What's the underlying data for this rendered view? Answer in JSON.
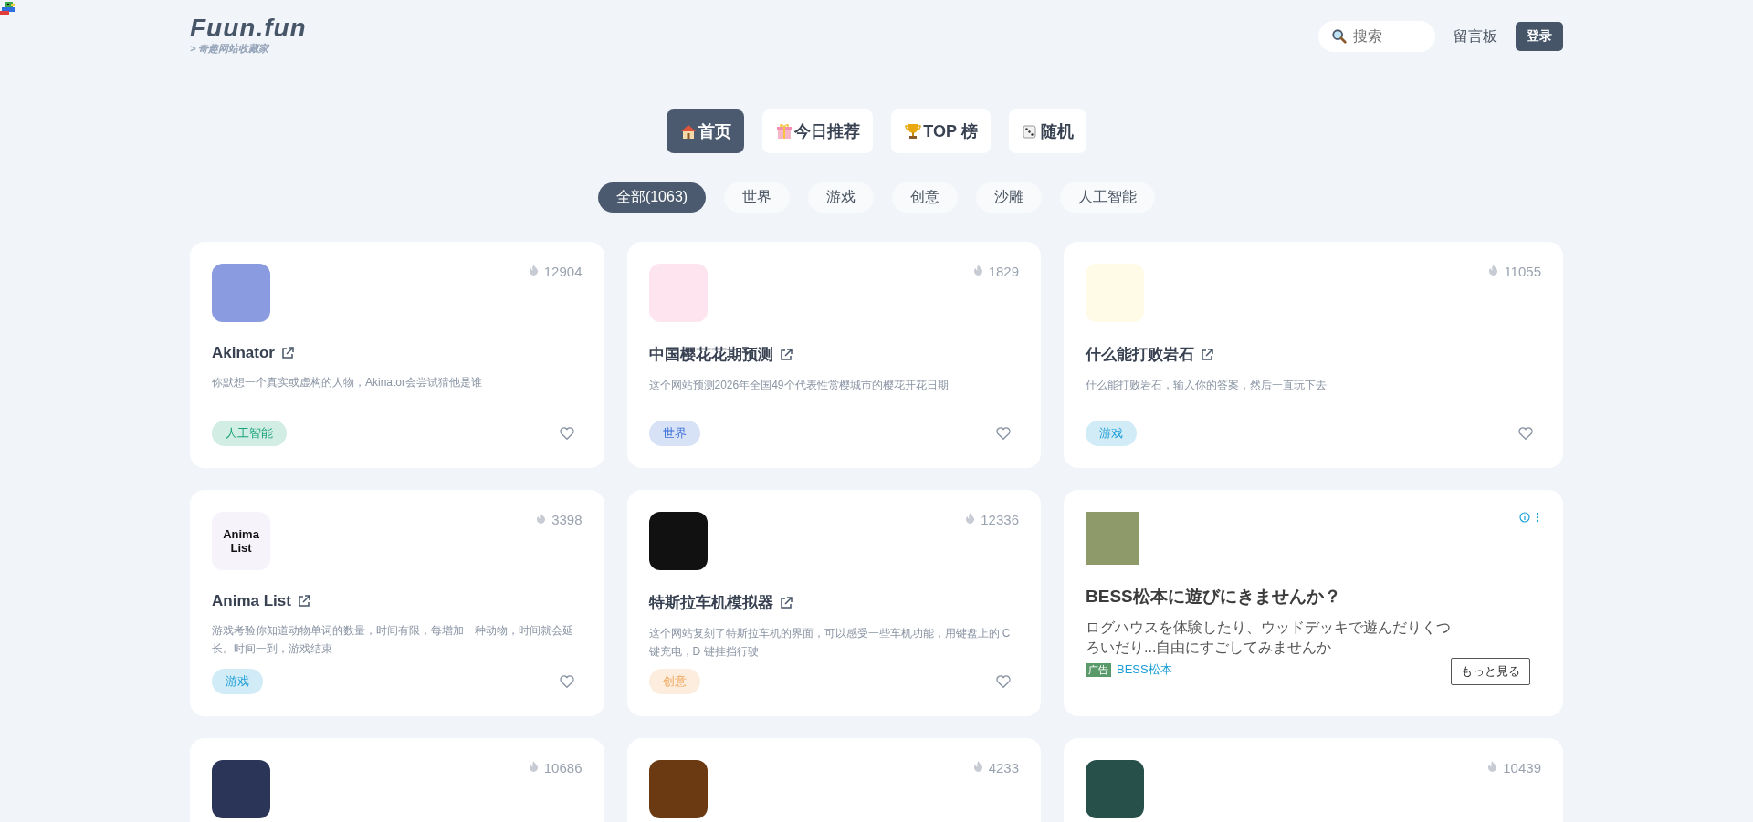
{
  "logo": {
    "text": "Fuun.fun",
    "tagline": "> 奇趣网站收藏家"
  },
  "header": {
    "search": {
      "placeholder": "搜索"
    },
    "guestbook": "留言板",
    "login": "登录"
  },
  "tabs": [
    {
      "label": "首页",
      "kind": "home",
      "selected": true
    },
    {
      "label": "今日推荐",
      "kind": "daily",
      "selected": false
    },
    {
      "label": "TOP 榜",
      "kind": "top",
      "selected": false
    },
    {
      "label": "随机",
      "kind": "random",
      "selected": false
    }
  ],
  "filters": [
    {
      "label": "全部(1063)",
      "selected": true
    },
    {
      "label": "世界",
      "selected": false
    },
    {
      "label": "游戏",
      "selected": false
    },
    {
      "label": "创意",
      "selected": false
    },
    {
      "label": "沙雕",
      "selected": false
    },
    {
      "label": "人工智能",
      "selected": false
    }
  ],
  "cards": [
    {
      "kind": "site",
      "count": "12904",
      "title": "Akinator",
      "description": "你默想一个真实或虚构的人物，Akinator会尝试猜他是谁",
      "tag": {
        "label": "人工智能",
        "color": "#1aa37a"
      }
    },
    {
      "kind": "site",
      "count": "1829",
      "title": "中国樱花花期预测",
      "description": "这个网站预测2026年全国49个代表性赏樱城市的樱花开花日期",
      "tag": {
        "label": "世界",
        "color": "#3b6fd6"
      }
    },
    {
      "kind": "site",
      "count": "11055",
      "title": "什么能打败岩石",
      "description": "什么能打败岩石，输入你的答案，然后一直玩下去",
      "tag": {
        "label": "游戏",
        "color": "#1d9ed6"
      }
    },
    {
      "kind": "site",
      "count": "3398",
      "icon_text": "Anima List",
      "title": "Anima List",
      "description": "游戏考验你知道动物单词的数量，时间有限，每增加一种动物，时间就会延长。时间一到，游戏结束",
      "tag": {
        "label": "游戏",
        "color": "#1d9ed6"
      }
    },
    {
      "kind": "site",
      "count": "12336",
      "title": "特斯拉车机模拟器",
      "description": "这个网站复刻了特斯拉车机的界面，可以感受一些车机功能，用键盘上的 C 键充电，D 键挂挡行驶",
      "tag": {
        "label": "创意",
        "color": "#f2a65a"
      }
    },
    {
      "kind": "ad",
      "title": "BESS松本に遊びにきませんか？",
      "text": "ログハウスを体験したり、ウッドデッキで遊んだりくつろいだり...自由にすごしてみませんか",
      "badge": "广告",
      "advertiser": "BESS松本",
      "button": "もっと見る"
    },
    {
      "kind": "site",
      "count": "10686"
    },
    {
      "kind": "site",
      "count": "4233"
    },
    {
      "kind": "site",
      "count": "10439"
    }
  ]
}
